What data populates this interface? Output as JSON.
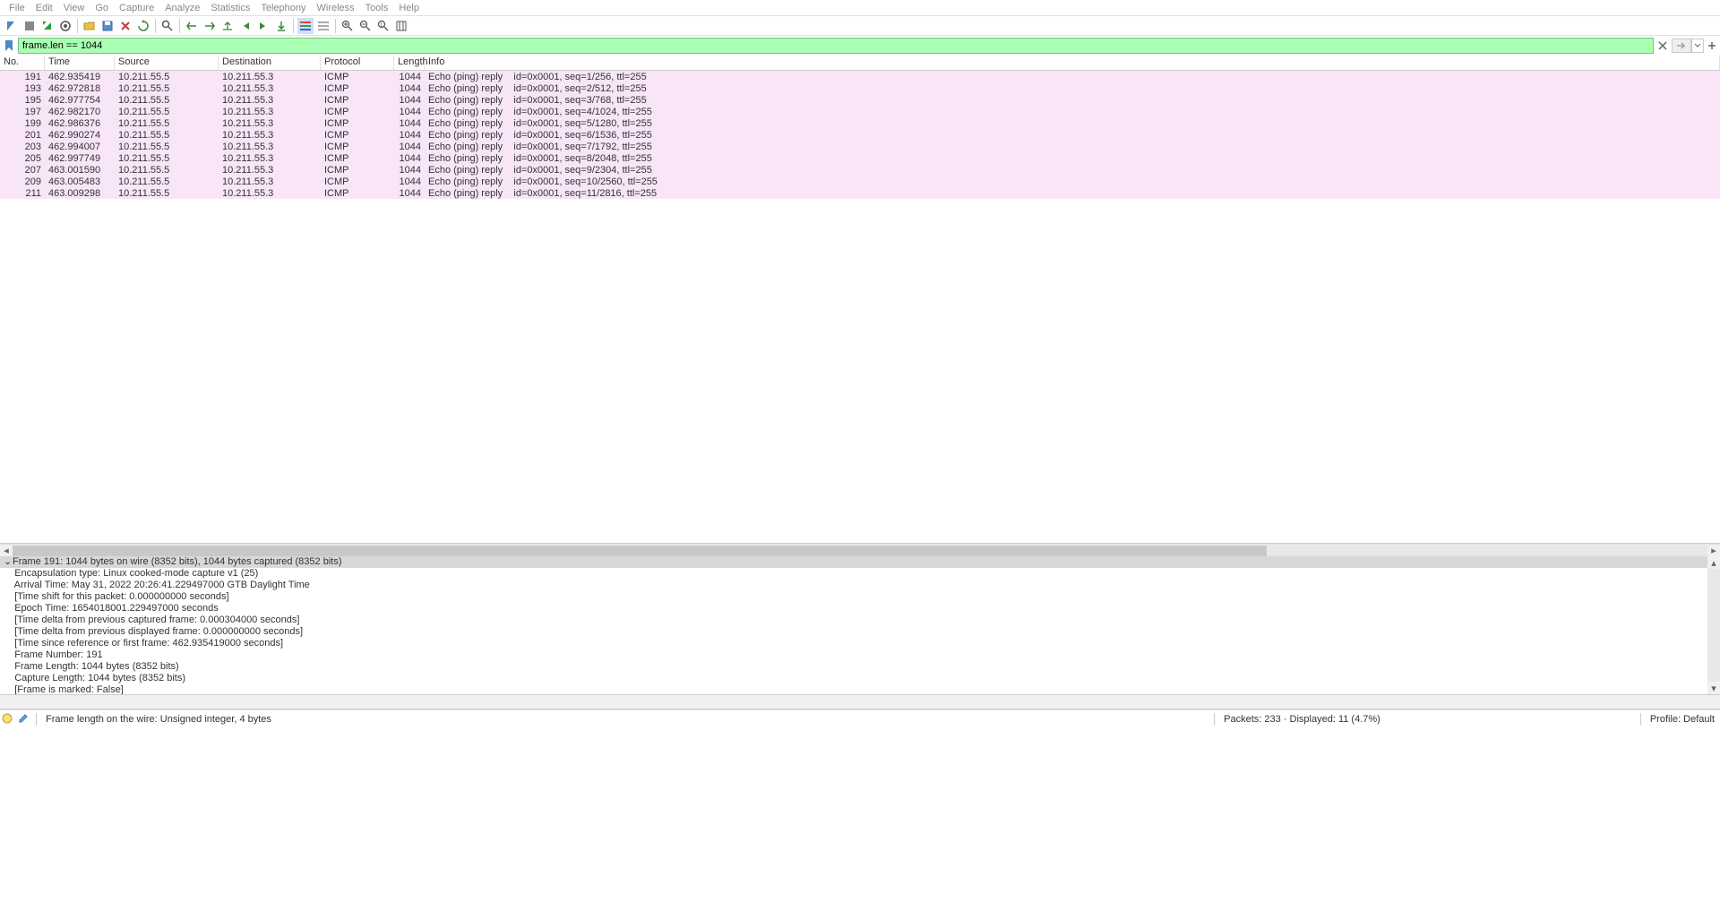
{
  "menu": [
    "File",
    "Edit",
    "View",
    "Go",
    "Capture",
    "Analyze",
    "Statistics",
    "Telephony",
    "Wireless",
    "Tools",
    "Help"
  ],
  "filter": {
    "value": "frame.len == 1044"
  },
  "columns": {
    "no": "No.",
    "time": "Time",
    "source": "Source",
    "destination": "Destination",
    "protocol": "Protocol",
    "length": "Length",
    "info": "Info"
  },
  "packets": [
    {
      "no": "191",
      "time": "462.935419",
      "src": "10.211.55.5",
      "dst": "10.211.55.3",
      "proto": "ICMP",
      "len": "1044",
      "info": "Echo (ping) reply    id=0x0001, seq=1/256, ttl=255",
      "sel": true
    },
    {
      "no": "193",
      "time": "462.972818",
      "src": "10.211.55.5",
      "dst": "10.211.55.3",
      "proto": "ICMP",
      "len": "1044",
      "info": "Echo (ping) reply    id=0x0001, seq=2/512, ttl=255"
    },
    {
      "no": "195",
      "time": "462.977754",
      "src": "10.211.55.5",
      "dst": "10.211.55.3",
      "proto": "ICMP",
      "len": "1044",
      "info": "Echo (ping) reply    id=0x0001, seq=3/768, ttl=255"
    },
    {
      "no": "197",
      "time": "462.982170",
      "src": "10.211.55.5",
      "dst": "10.211.55.3",
      "proto": "ICMP",
      "len": "1044",
      "info": "Echo (ping) reply    id=0x0001, seq=4/1024, ttl=255"
    },
    {
      "no": "199",
      "time": "462.986376",
      "src": "10.211.55.5",
      "dst": "10.211.55.3",
      "proto": "ICMP",
      "len": "1044",
      "info": "Echo (ping) reply    id=0x0001, seq=5/1280, ttl=255"
    },
    {
      "no": "201",
      "time": "462.990274",
      "src": "10.211.55.5",
      "dst": "10.211.55.3",
      "proto": "ICMP",
      "len": "1044",
      "info": "Echo (ping) reply    id=0x0001, seq=6/1536, ttl=255"
    },
    {
      "no": "203",
      "time": "462.994007",
      "src": "10.211.55.5",
      "dst": "10.211.55.3",
      "proto": "ICMP",
      "len": "1044",
      "info": "Echo (ping) reply    id=0x0001, seq=7/1792, ttl=255"
    },
    {
      "no": "205",
      "time": "462.997749",
      "src": "10.211.55.5",
      "dst": "10.211.55.3",
      "proto": "ICMP",
      "len": "1044",
      "info": "Echo (ping) reply    id=0x0001, seq=8/2048, ttl=255"
    },
    {
      "no": "207",
      "time": "463.001590",
      "src": "10.211.55.5",
      "dst": "10.211.55.3",
      "proto": "ICMP",
      "len": "1044",
      "info": "Echo (ping) reply    id=0x0001, seq=9/2304, ttl=255"
    },
    {
      "no": "209",
      "time": "463.005483",
      "src": "10.211.55.5",
      "dst": "10.211.55.3",
      "proto": "ICMP",
      "len": "1044",
      "info": "Echo (ping) reply    id=0x0001, seq=10/2560, ttl=255"
    },
    {
      "no": "211",
      "time": "463.009298",
      "src": "10.211.55.5",
      "dst": "10.211.55.3",
      "proto": "ICMP",
      "len": "1044",
      "info": "Echo (ping) reply    id=0x0001, seq=11/2816, ttl=255"
    }
  ],
  "details": {
    "header": "Frame 191: 1044 bytes on wire (8352 bits), 1044 bytes captured (8352 bits)",
    "lines": [
      "Encapsulation type: Linux cooked-mode capture v1 (25)",
      "Arrival Time: May 31, 2022 20:26:41.229497000 GTB Daylight Time",
      "[Time shift for this packet: 0.000000000 seconds]",
      "Epoch Time: 1654018001.229497000 seconds",
      "[Time delta from previous captured frame: 0.000304000 seconds]",
      "[Time delta from previous displayed frame: 0.000000000 seconds]",
      "[Time since reference or first frame: 462.935419000 seconds]",
      "Frame Number: 191",
      "Frame Length: 1044 bytes (8352 bits)",
      "Capture Length: 1044 bytes (8352 bits)",
      "[Frame is marked: False]"
    ]
  },
  "status": {
    "left": "Frame length on the wire: Unsigned integer, 4 bytes",
    "packets": "Packets: 233 · Displayed: 11 (4.7%)",
    "profile": "Profile: Default"
  }
}
